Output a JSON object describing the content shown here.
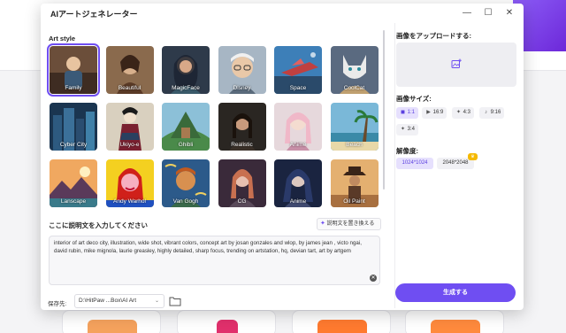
{
  "window": {
    "title": "AIアートジェネレーター"
  },
  "left": {
    "art_style_label": "Art style",
    "styles": [
      {
        "label": "Family",
        "selected": true
      },
      {
        "label": "Beautiful",
        "selected": false
      },
      {
        "label": "MagicFace",
        "selected": false
      },
      {
        "label": "Disney",
        "selected": false
      },
      {
        "label": "Space",
        "selected": false
      },
      {
        "label": "CoolCat",
        "selected": false
      },
      {
        "label": "Cyber City",
        "selected": false
      },
      {
        "label": "Ukiyo-e",
        "selected": false
      },
      {
        "label": "Ghibli",
        "selected": false
      },
      {
        "label": "Realistic",
        "selected": false
      },
      {
        "label": "Anime",
        "selected": false
      },
      {
        "label": "Beach",
        "selected": false
      },
      {
        "label": "Lanscape",
        "selected": false
      },
      {
        "label": "Andy Warhol",
        "selected": false
      },
      {
        "label": "Van Gogh",
        "selected": false
      },
      {
        "label": "CG",
        "selected": false
      },
      {
        "label": "Anime",
        "selected": false
      },
      {
        "label": "Oil Paint",
        "selected": false
      }
    ],
    "description_label": "ここに説明文を入力してください",
    "replace_button": "説明文を置き換える",
    "prompt_text": "interior of art deco city, illustration, wide shot, vibrant colors, concept art by josan gonzales and wlop, by james jean , victo ngai, david rubin, mike mignola, laurie greasley, highly detailed, sharp focus, trending on artstation, hq, devian tart, art by artgem",
    "save_label": "保存先:",
    "save_path": "D:\\HitPaw ...Box\\AI Art"
  },
  "right": {
    "upload_label": "画像をアップロードする:",
    "size_label": "画像サイズ:",
    "sizes": [
      {
        "label": "1:1",
        "icon": "square-ratio-icon",
        "active": true
      },
      {
        "label": "16:9",
        "icon": "youtube-icon",
        "active": false
      },
      {
        "label": "4:3",
        "icon": "twitter-icon",
        "active": false
      },
      {
        "label": "9:16",
        "icon": "tiktok-icon",
        "active": false
      },
      {
        "label": "3:4",
        "icon": "twitter-icon",
        "active": false
      }
    ],
    "resolution_label": "解像度:",
    "resolutions": [
      {
        "label": "1024*1024",
        "active": true
      },
      {
        "label": "2048*2048",
        "active": false
      }
    ],
    "generate_button": "生成する"
  },
  "colors": {
    "accent": "#6f4ef2"
  }
}
